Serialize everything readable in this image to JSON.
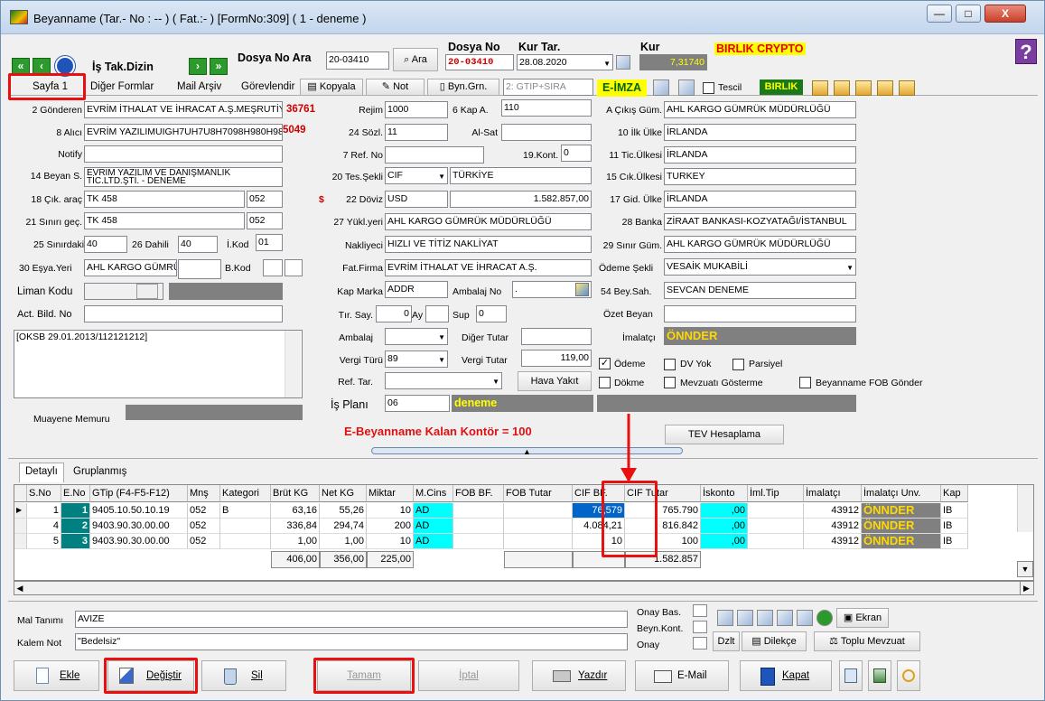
{
  "window": {
    "title": "Beyanname (Tar.- No : -- ) ( Fat.:- )  [FormNo:309] ( 1 - deneme )",
    "minimize": "—",
    "maximize": "□",
    "close": "X"
  },
  "header": {
    "is_tak_dizin": "İş Tak.Dizin",
    "dosya_no_ara_label": "Dosya No Ara",
    "dosya_no_ara_value": "20-03410",
    "ara_button": "Ara",
    "dosya_no_label": "Dosya No",
    "dosya_no_value": "20-03410",
    "kur_tar_label": "Kur Tar.",
    "kur_tar_value": "28.08.2020",
    "kur_label": "Kur",
    "kur_value": "7,31740",
    "company": "BIRLIK CRYPTO",
    "help": "?"
  },
  "tabs": [
    {
      "label": "Sayfa 1"
    },
    {
      "label": "Diğer Formlar"
    },
    {
      "label": "Mail Arşiv"
    },
    {
      "label": "Görevlendirme"
    }
  ],
  "toolbar": {
    "kopyala": "Kopyala",
    "not": "Not",
    "byn_grn": "Byn.Grn.",
    "gtip_sira": "2: GTIP+SIRA",
    "e_imza": "E-İMZA",
    "tescil": "Tescil",
    "birlik": "BIRLIK"
  },
  "form": {
    "gonderen_label": "2 Gönderen",
    "gonderen_value": "EVRİM İTHALAT VE İHRACAT A.Ş.MEŞRUTİY",
    "gonderen_no": "36761",
    "alici_label": "8 Alıcı",
    "alici_value": "EVRİM YAZILIMUIGH7UH7U8H7098H980H98",
    "alici_no": "5049",
    "notify_label": "Notify",
    "beyan_label": "14 Beyan S.",
    "beyan_value": "EVRİM YAZILIM VE DANIŞMANLIK",
    "beyan_value2": "TİC.LTD.ŞTİ. - DENEME",
    "cik_arac_label": "18 Çık. araç",
    "cik_arac_value": "TK 458",
    "cik_arac_code": "052",
    "siniri_gec_label": "21 Sınırı geç.",
    "siniri_gec_value": "TK 458",
    "siniri_gec_code": "052",
    "sinirdaki_label": "25 Sınırdaki",
    "sinirdaki_value": "40",
    "dahili_label": "26 Dahili",
    "dahili_value": "40",
    "i_kod_label": "İ.Kod",
    "i_kod_value": "01",
    "esya_yeri_label": "30 Eşya.Yeri",
    "esya_yeri_value": "AHL KARGO GÜMRÜ",
    "b_kod_label": "B.Kod",
    "liman_kodu_label": "Liman Kodu",
    "act_bild_label": "Act. Bild. No",
    "rejim_label": "Rejim",
    "rejim_value": "1000",
    "kap_a_label": "6 Kap A.",
    "kap_a_value": "110",
    "sozl_label": "24 Sözl.",
    "sozl_value": "11",
    "al_sat_label": "Al-Sat",
    "ref_no_label": "7 Ref. No",
    "kont_label": "19.Kont.",
    "kont_value": "0",
    "tes_sekli_label": "20 Tes.Şekli",
    "tes_sekli_value": "CIF",
    "tes_ulke_value": "TÜRKİYE",
    "doviz_label": "22 Döviz",
    "doviz_value": "USD",
    "doviz_amount": "1.582.857,00",
    "dollar": "$",
    "yukleyeri_label": "27 Yükl.yeri",
    "yukleyeri_value": "AHL KARGO GÜMRÜK MÜDÜRLÜĞÜ",
    "nakliyeci_label": "Nakliyeci",
    "nakliyeci_value": "HIZLI VE TİTİZ NAKLİYAT",
    "fat_firma_label": "Fat.Firma",
    "fat_firma_value": "EVRİM İTHALAT VE İHRACAT A.Ş.",
    "kap_marka_label": "Kap Marka",
    "kap_marka_value": "ADDR",
    "ambalaj_no_label": "Ambalaj No",
    "ambalaj_no_value": ".",
    "tir_say_label": "Tır. Say.",
    "tir_say_value": "0",
    "ay_label": "Ay",
    "sup_label": "Sup",
    "sup_value": "0",
    "ambalaj_label": "Ambalaj",
    "diger_tutar_label": "Diğer Tutar",
    "vergi_turu_label": "Vergi Türü",
    "vergi_turu_value": "89",
    "vergi_tutar_label": "Vergi Tutar",
    "vergi_tutar_value": "119,00",
    "ref_tar_label": "Ref. Tar.",
    "hava_yakit": "Hava Yakıt",
    "is_plani_label": "İş Planı",
    "is_plani_value": "06",
    "is_plani_name": "deneme",
    "kontor": "E-Beyanname Kalan Kontör = 100",
    "cikis_gum_label": "A Çıkış Güm.",
    "cikis_gum_value": "AHL KARGO GÜMRÜK MÜDÜRLÜĞÜ",
    "ilk_ulke_label": "10 İlk Ülke",
    "ilk_ulke_value": "İRLANDA",
    "tic_ulkesi_label": "11 Tic.Ülkesi",
    "tic_ulkesi_value": "İRLANDA",
    "cik_ulkesi_label": "15 Cık.Ülkesi",
    "cik_ulkesi_value": "TURKEY",
    "gid_ulke_label": "17 Gid. Ülke",
    "gid_ulke_value": "İRLANDA",
    "banka_label": "28 Banka",
    "banka_value": "ZİRAAT BANKASI-KOZYATAĞI/İSTANBUL",
    "sinir_gum_label": "29 Sınır Güm.",
    "sinir_gum_value": "AHL KARGO GÜMRÜK MÜDÜRLÜĞÜ",
    "odeme_sekli_label": "Ödeme Şekli",
    "odeme_sekli_value": "VESAİK MUKABİLİ",
    "bey_sah_label": "54 Bey.Sah.",
    "bey_sah_value": "SEVCAN DENEME",
    "ozet_beyan_label": "Özet Beyan",
    "imalatci_label": "İmalatçı",
    "imalatci_value": "ÖNNDER",
    "odeme_chk": "Ödeme",
    "dv_yok_chk": "DV Yok",
    "parsiyel_chk": "Parsiyel",
    "dokme_chk": "Dökme",
    "mevzuati_chk": "Mevzuatı Gösterme",
    "beyanname_fob_chk": "Beyanname FOB Gönder",
    "tev_hesaplama": "TEV Hesaplama",
    "note_text": "[OKSB 29.01.2013/112121212]",
    "muayene_label": "Muayene Memuru"
  },
  "grid": {
    "tabs": [
      "Detaylı",
      "Gruplanmış"
    ],
    "columns": [
      "S.No",
      "E.No",
      "GTip (F4-F5-F12)",
      "Mnş",
      "Kategori",
      "Brüt KG",
      "Net KG",
      "Miktar",
      "M.Cins",
      "FOB BF.",
      "FOB Tutar",
      "CIF BF.",
      "CIF Tutar",
      "İskonto",
      "İml.Tip",
      "İmalatçı",
      "İmalatçı Unv.",
      "Kap"
    ],
    "rows": [
      {
        "sno": "1",
        "eno": "1",
        "gtip": "9405.10.50.10.19",
        "mns": "052",
        "kat": "B",
        "brut": "63,16",
        "net": "55,26",
        "miktar": "10",
        "mcins": "AD",
        "fobbf": "",
        "fobtutar": "",
        "cifbf": "76,579",
        "ciftutar": "765.790",
        "iskonto": ",00",
        "imltip": "",
        "imalatci": "43912",
        "unv": "ÖNNDER",
        "kap": "IB"
      },
      {
        "sno": "4",
        "eno": "2",
        "gtip": "9403.90.30.00.00",
        "mns": "052",
        "kat": "",
        "brut": "336,84",
        "net": "294,74",
        "miktar": "200",
        "mcins": "AD",
        "fobbf": "",
        "fobtutar": "",
        "cifbf": "4.084,21",
        "ciftutar": "816.842",
        "iskonto": ",00",
        "imltip": "",
        "imalatci": "43912",
        "unv": "ÖNNDER",
        "kap": "IB"
      },
      {
        "sno": "5",
        "eno": "3",
        "gtip": "9403.90.30.00.00",
        "mns": "052",
        "kat": "",
        "brut": "1,00",
        "net": "1,00",
        "miktar": "10",
        "mcins": "AD",
        "fobbf": "",
        "fobtutar": "",
        "cifbf": "10",
        "ciftutar": "100",
        "iskonto": ",00",
        "imltip": "",
        "imalatci": "43912",
        "unv": "ÖNNDER",
        "kap": "IB"
      }
    ],
    "totals": {
      "brut": "406,00",
      "net": "356,00",
      "miktar": "225,00",
      "ciftutar": "1.582.857"
    }
  },
  "bottom": {
    "mal_tanimi_label": "Mal Tanımı",
    "mal_tanimi_value": "AVIZE",
    "kalem_not_label": "Kalem Not",
    "kalem_not_value": "\"Bedelsiz\"",
    "onay_bas": "Onay Bas.",
    "beyn_kont": "Beyn.Kont.",
    "onay": "Onay",
    "ekran": "Ekran",
    "dzlt": "Dzlt",
    "dilekce": "Dilekçe",
    "toplu_mevzuat": "Toplu Mevzuat"
  },
  "actions": {
    "ekle": "Ekle",
    "degistir": "Değiştir",
    "sil": "Sil",
    "tamam": "Tamam",
    "iptal": "İptal",
    "yazdir": "Yazdır",
    "email": "E-Mail",
    "kapat": "Kapat"
  }
}
